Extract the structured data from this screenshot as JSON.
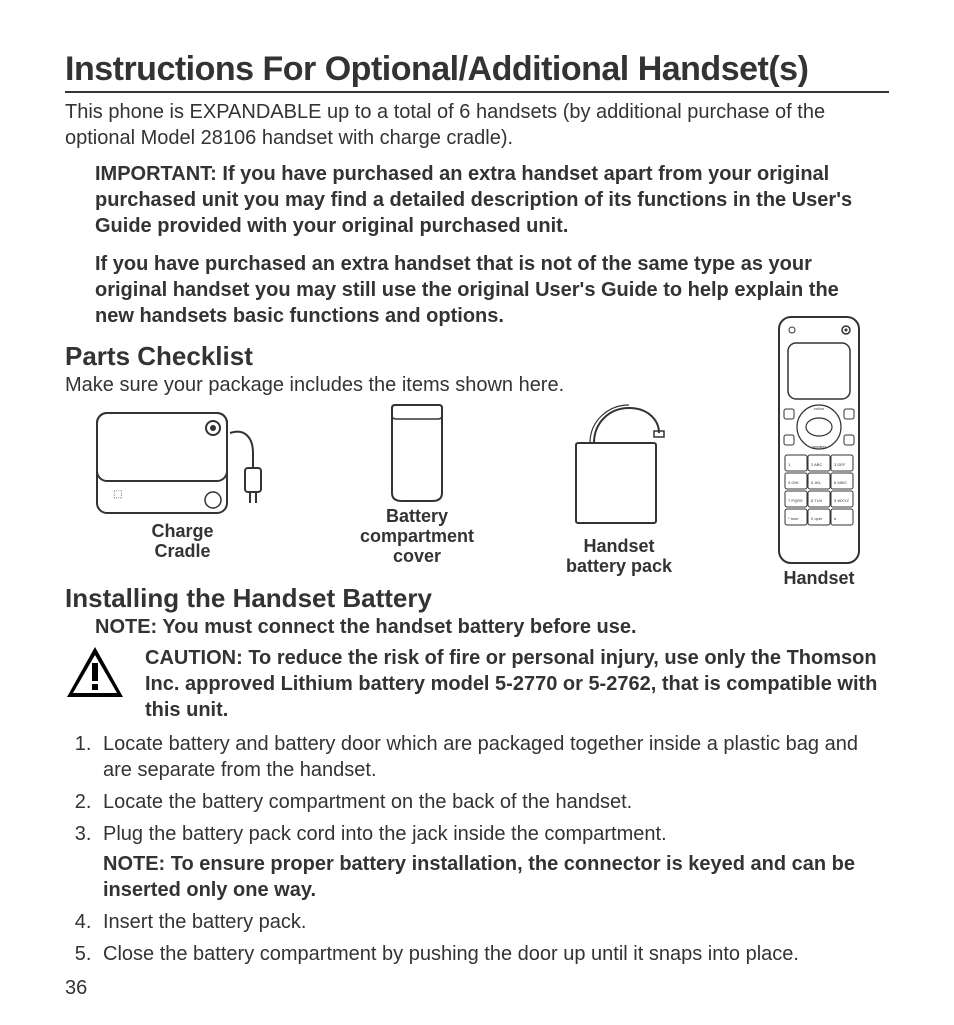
{
  "title": "Instructions For Optional/Additional Handset(s)",
  "intro": "This phone is EXPANDABLE up to a total of 6 handsets (by additional purchase of the optional Model 28106 handset with charge cradle).",
  "important": {
    "p1": "IMPORTANT: If you have purchased an extra handset apart from your original purchased unit you may find a detailed description of its functions in the User's Guide provided with your original purchased unit.",
    "p2": "If you have purchased an extra handset that is not of the same type as your original handset you may still use the original User's Guide to help explain the new handsets basic functions and options."
  },
  "parts": {
    "heading": "Parts Checklist",
    "intro": "Make sure your package includes the items shown here.",
    "cradle_label": "Charge\nCradle",
    "cover_label": "Battery\ncompartment\ncover",
    "battery_label": "Handset\nbattery pack",
    "handset_label": "Handset"
  },
  "install": {
    "heading": "Installing the Handset Battery",
    "note": "NOTE: You must connect the handset battery before use.",
    "caution": "CAUTION: To reduce the risk of fire or personal injury, use only the Thomson Inc. approved Lithium battery model 5-2770 or 5-2762, that is compatible with this unit.",
    "steps": [
      "Locate battery and battery door which are packaged together inside a plastic bag and are separate from the handset.",
      "Locate the battery compartment on the back of the handset.",
      "Plug the battery pack cord into the jack inside  the compartment.",
      "Insert the battery pack.",
      "Close the battery compartment by pushing the door up until it snaps into place."
    ],
    "step3_note": "NOTE: To ensure proper battery installation, the connector is keyed and can be inserted only one way."
  },
  "page_number": "36"
}
